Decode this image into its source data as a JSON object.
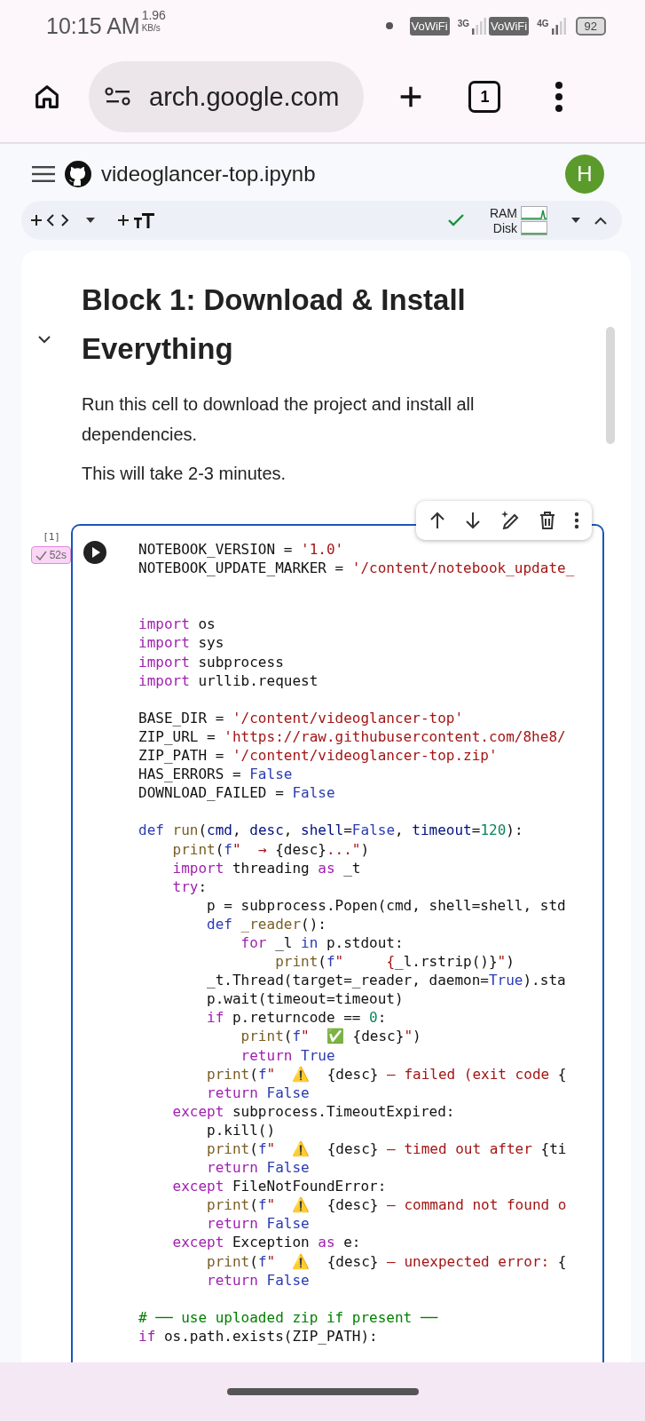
{
  "status_bar": {
    "time": "10:15 AM",
    "speed": "1.96",
    "speed_unit": "KB/s",
    "network_badges": [
      "VoWiFi",
      "VoWiFi"
    ],
    "network_types": [
      "3G",
      "4G"
    ],
    "battery": "92"
  },
  "browser": {
    "url": "arch.google.com",
    "tab_count": "1"
  },
  "notebook": {
    "title": "videoglancer-top.ipynb",
    "avatar": "H"
  },
  "toolbar": {
    "ram_label": "RAM",
    "disk_label": "Disk"
  },
  "text_cell": {
    "heading": "Block 1: Download & Install Everything",
    "paragraphs": [
      "Run this cell to download the project and install all dependencies.",
      "This will take 2-3 minutes."
    ]
  },
  "code_cell": {
    "execution_count": "[1]",
    "duration": "52s",
    "lines": [
      {
        "kind": "code",
        "tokens": [
          {
            "kind": "plain",
            "text": "NOTEBOOK_VERSION = "
          },
          {
            "kind": "str",
            "text": "'1.0'"
          }
        ]
      },
      {
        "kind": "code",
        "tokens": [
          {
            "kind": "plain",
            "text": "NOTEBOOK_UPDATE_MARKER = "
          },
          {
            "kind": "str",
            "text": "'/content/notebook_update_"
          }
        ]
      },
      {
        "kind": "blank"
      },
      {
        "kind": "blank"
      },
      {
        "kind": "code",
        "tokens": [
          {
            "kind": "kw",
            "text": "import"
          },
          {
            "kind": "plain",
            "text": " os"
          }
        ]
      },
      {
        "kind": "code",
        "tokens": [
          {
            "kind": "kw",
            "text": "import"
          },
          {
            "kind": "plain",
            "text": " sys"
          }
        ]
      },
      {
        "kind": "code",
        "tokens": [
          {
            "kind": "kw",
            "text": "import"
          },
          {
            "kind": "plain",
            "text": " subprocess"
          }
        ]
      },
      {
        "kind": "code",
        "tokens": [
          {
            "kind": "kw",
            "text": "import"
          },
          {
            "kind": "plain",
            "text": " urllib.request"
          }
        ]
      },
      {
        "kind": "blank"
      },
      {
        "kind": "code",
        "tokens": [
          {
            "kind": "plain",
            "text": "BASE_DIR = "
          },
          {
            "kind": "str",
            "text": "'/content/videoglancer-top'"
          }
        ]
      },
      {
        "kind": "code",
        "tokens": [
          {
            "kind": "plain",
            "text": "ZIP_URL = "
          },
          {
            "kind": "str",
            "text": "'https://raw.githubusercontent.com/8he8/"
          }
        ]
      },
      {
        "kind": "code",
        "tokens": [
          {
            "kind": "plain",
            "text": "ZIP_PATH = "
          },
          {
            "kind": "str",
            "text": "'/content/videoglancer-top.zip'"
          }
        ]
      },
      {
        "kind": "code",
        "tokens": [
          {
            "kind": "plain",
            "text": "HAS_ERRORS = "
          },
          {
            "kind": "const",
            "text": "False"
          }
        ]
      },
      {
        "kind": "code",
        "tokens": [
          {
            "kind": "plain",
            "text": "DOWNLOAD_FAILED = "
          },
          {
            "kind": "const",
            "text": "False"
          }
        ]
      },
      {
        "kind": "blank"
      },
      {
        "kind": "code",
        "tokens": [
          {
            "kind": "const",
            "text": "def"
          },
          {
            "kind": "fn",
            "text": " run"
          },
          {
            "kind": "plain",
            "text": "("
          },
          {
            "kind": "param",
            "text": "cmd"
          },
          {
            "kind": "plain",
            "text": ", "
          },
          {
            "kind": "param",
            "text": "desc"
          },
          {
            "kind": "plain",
            "text": ", "
          },
          {
            "kind": "param",
            "text": "shell"
          },
          {
            "kind": "plain",
            "text": "="
          },
          {
            "kind": "const",
            "text": "False"
          },
          {
            "kind": "plain",
            "text": ", "
          },
          {
            "kind": "param",
            "text": "timeout"
          },
          {
            "kind": "plain",
            "text": "="
          },
          {
            "kind": "num",
            "text": "120"
          },
          {
            "kind": "plain",
            "text": "):"
          }
        ]
      },
      {
        "kind": "code",
        "tokens": [
          {
            "kind": "fn",
            "text": "    print"
          },
          {
            "kind": "plain",
            "text": "("
          },
          {
            "kind": "const",
            "text": "f"
          },
          {
            "kind": "str",
            "text": "\"  → "
          },
          {
            "kind": "plain",
            "text": "{desc}"
          },
          {
            "kind": "str",
            "text": "...\""
          },
          {
            "kind": "plain",
            "text": ")"
          }
        ]
      },
      {
        "kind": "code",
        "tokens": [
          {
            "kind": "kw",
            "text": "    import"
          },
          {
            "kind": "plain",
            "text": " threading "
          },
          {
            "kind": "kw",
            "text": "as"
          },
          {
            "kind": "plain",
            "text": " _t"
          }
        ]
      },
      {
        "kind": "code",
        "tokens": [
          {
            "kind": "kw",
            "text": "    try"
          },
          {
            "kind": "plain",
            "text": ":"
          }
        ]
      },
      {
        "kind": "code",
        "tokens": [
          {
            "kind": "plain",
            "text": "        p = subprocess.Popen(cmd, shell=shell, std"
          }
        ]
      },
      {
        "kind": "code",
        "tokens": [
          {
            "kind": "const",
            "text": "        def"
          },
          {
            "kind": "fn",
            "text": " _reader"
          },
          {
            "kind": "plain",
            "text": "():"
          }
        ]
      },
      {
        "kind": "code",
        "tokens": [
          {
            "kind": "kw",
            "text": "            for"
          },
          {
            "kind": "plain",
            "text": " _l "
          },
          {
            "kind": "const",
            "text": "in"
          },
          {
            "kind": "plain",
            "text": " p.stdout:"
          }
        ]
      },
      {
        "kind": "code",
        "tokens": [
          {
            "kind": "fn",
            "text": "                print"
          },
          {
            "kind": "plain",
            "text": "("
          },
          {
            "kind": "const",
            "text": "f"
          },
          {
            "kind": "str",
            "text": "\"     {"
          },
          {
            "kind": "plain",
            "text": "_l.rstrip()}"
          },
          {
            "kind": "str",
            "text": "\""
          },
          {
            "kind": "plain",
            "text": ")"
          }
        ]
      },
      {
        "kind": "code",
        "tokens": [
          {
            "kind": "plain",
            "text": "        _t.Thread(target=_reader, daemon="
          },
          {
            "kind": "const",
            "text": "True"
          },
          {
            "kind": "plain",
            "text": ").sta"
          }
        ]
      },
      {
        "kind": "code",
        "tokens": [
          {
            "kind": "plain",
            "text": "        p.wait(timeout=timeout)"
          }
        ]
      },
      {
        "kind": "code",
        "tokens": [
          {
            "kind": "kw",
            "text": "        if"
          },
          {
            "kind": "plain",
            "text": " p.returncode == "
          },
          {
            "kind": "num",
            "text": "0"
          },
          {
            "kind": "plain",
            "text": ":"
          }
        ]
      },
      {
        "kind": "code",
        "tokens": [
          {
            "kind": "fn",
            "text": "            print"
          },
          {
            "kind": "plain",
            "text": "("
          },
          {
            "kind": "const",
            "text": "f"
          },
          {
            "kind": "str",
            "text": "\"  ✅ "
          },
          {
            "kind": "plain",
            "text": "{desc}"
          },
          {
            "kind": "str",
            "text": "\""
          },
          {
            "kind": "plain",
            "text": ")"
          }
        ]
      },
      {
        "kind": "code",
        "tokens": [
          {
            "kind": "kw",
            "text": "            return"
          },
          {
            "kind": "const",
            "text": " True"
          }
        ]
      },
      {
        "kind": "code",
        "tokens": [
          {
            "kind": "fn",
            "text": "        print"
          },
          {
            "kind": "plain",
            "text": "("
          },
          {
            "kind": "const",
            "text": "f"
          },
          {
            "kind": "str",
            "text": "\"  ⚠️  "
          },
          {
            "kind": "plain",
            "text": "{desc}"
          },
          {
            "kind": "str",
            "text": " — failed (exit code "
          },
          {
            "kind": "plain",
            "text": "{"
          }
        ]
      },
      {
        "kind": "code",
        "tokens": [
          {
            "kind": "kw",
            "text": "        return"
          },
          {
            "kind": "const",
            "text": " False"
          }
        ]
      },
      {
        "kind": "code",
        "tokens": [
          {
            "kind": "kw",
            "text": "    except"
          },
          {
            "kind": "plain",
            "text": " subprocess.TimeoutExpired:"
          }
        ]
      },
      {
        "kind": "code",
        "tokens": [
          {
            "kind": "plain",
            "text": "        p.kill()"
          }
        ]
      },
      {
        "kind": "code",
        "tokens": [
          {
            "kind": "fn",
            "text": "        print"
          },
          {
            "kind": "plain",
            "text": "("
          },
          {
            "kind": "const",
            "text": "f"
          },
          {
            "kind": "str",
            "text": "\"  ⚠️  "
          },
          {
            "kind": "plain",
            "text": "{desc}"
          },
          {
            "kind": "str",
            "text": " — timed out after "
          },
          {
            "kind": "plain",
            "text": "{ti"
          }
        ]
      },
      {
        "kind": "code",
        "tokens": [
          {
            "kind": "kw",
            "text": "        return"
          },
          {
            "kind": "const",
            "text": " False"
          }
        ]
      },
      {
        "kind": "code",
        "tokens": [
          {
            "kind": "kw",
            "text": "    except"
          },
          {
            "kind": "plain",
            "text": " FileNotFoundError:"
          }
        ]
      },
      {
        "kind": "code",
        "tokens": [
          {
            "kind": "fn",
            "text": "        print"
          },
          {
            "kind": "plain",
            "text": "("
          },
          {
            "kind": "const",
            "text": "f"
          },
          {
            "kind": "str",
            "text": "\"  ⚠️  "
          },
          {
            "kind": "plain",
            "text": "{desc}"
          },
          {
            "kind": "str",
            "text": " — command not found o"
          }
        ]
      },
      {
        "kind": "code",
        "tokens": [
          {
            "kind": "kw",
            "text": "        return"
          },
          {
            "kind": "const",
            "text": " False"
          }
        ]
      },
      {
        "kind": "code",
        "tokens": [
          {
            "kind": "kw",
            "text": "    except"
          },
          {
            "kind": "plain",
            "text": " Exception "
          },
          {
            "kind": "kw",
            "text": "as"
          },
          {
            "kind": "plain",
            "text": " e:"
          }
        ]
      },
      {
        "kind": "code",
        "tokens": [
          {
            "kind": "fn",
            "text": "        print"
          },
          {
            "kind": "plain",
            "text": "("
          },
          {
            "kind": "const",
            "text": "f"
          },
          {
            "kind": "str",
            "text": "\"  ⚠️  "
          },
          {
            "kind": "plain",
            "text": "{desc}"
          },
          {
            "kind": "str",
            "text": " — unexpected error: "
          },
          {
            "kind": "plain",
            "text": "{"
          }
        ]
      },
      {
        "kind": "code",
        "tokens": [
          {
            "kind": "kw",
            "text": "        return"
          },
          {
            "kind": "const",
            "text": " False"
          }
        ]
      },
      {
        "kind": "blank"
      },
      {
        "kind": "code",
        "tokens": [
          {
            "kind": "cmt",
            "text": "# ── use uploaded zip if present ──"
          }
        ]
      },
      {
        "kind": "code",
        "tokens": [
          {
            "kind": "kw",
            "text": "if"
          },
          {
            "kind": "plain",
            "text": " os.path.exists(ZIP_PATH):"
          }
        ]
      }
    ]
  }
}
